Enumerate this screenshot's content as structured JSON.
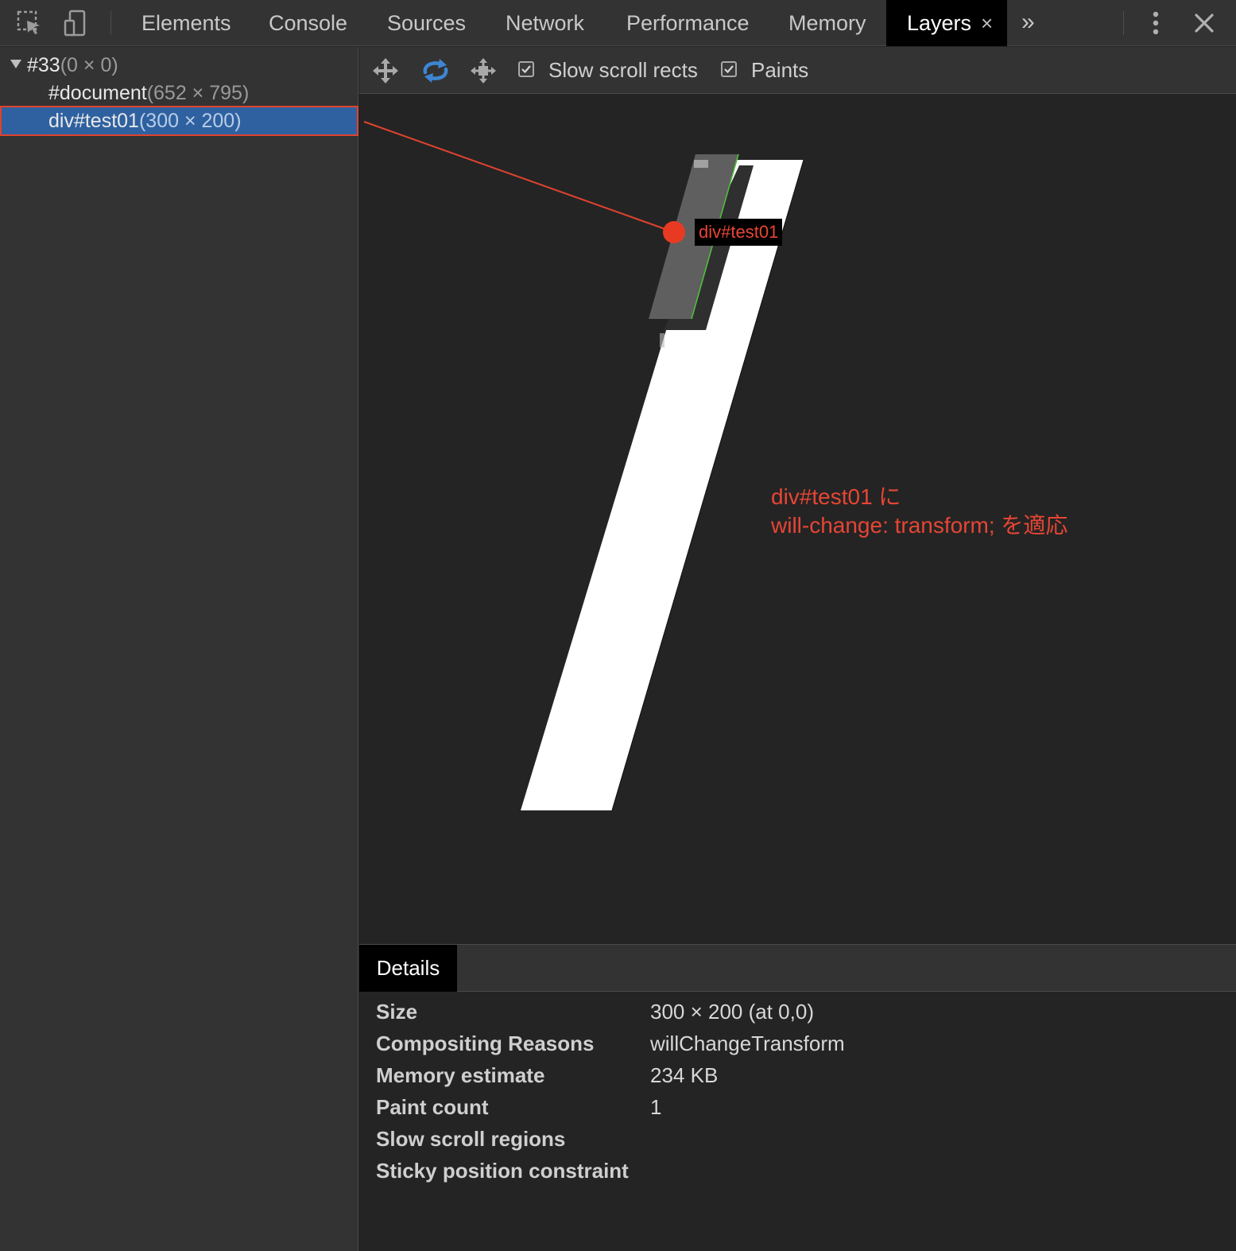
{
  "toolbar": {
    "tabs": [
      "Elements",
      "Console",
      "Sources",
      "Network",
      "Performance",
      "Memory",
      "Layers"
    ],
    "active_tab": "Layers",
    "close_glyph": "×",
    "more_glyph": "»",
    "icons": [
      "inspect-element-icon",
      "device-toolbar-icon",
      "more-tabs-icon",
      "kebab-menu-icon",
      "close-icon"
    ]
  },
  "tree": {
    "root": {
      "name": "#33",
      "dims": "(0 × 0)"
    },
    "items": [
      {
        "name": "#document",
        "dims": "(652 × 795)"
      },
      {
        "name": "div#test01",
        "dims": "(300 × 200)"
      }
    ],
    "selected": "div#test01"
  },
  "layers_toolbar": {
    "icons": [
      "pan-mode-icon",
      "rotate-mode-icon",
      "reset-transform-icon"
    ],
    "active_icon": "rotate-mode-icon",
    "checkboxes": [
      {
        "label": "Slow scroll rects",
        "checked": true
      },
      {
        "label": "Paints",
        "checked": true
      }
    ]
  },
  "viewport": {
    "hover_label": "div#test01",
    "annotation": [
      "div#test01 に",
      "will-change: transform; を適応"
    ],
    "annotation_color": "#e74534"
  },
  "details": {
    "tab": "Details",
    "rows": [
      {
        "key": "Size",
        "value": "300 × 200 (at 0,0)"
      },
      {
        "key": "Compositing Reasons",
        "value": "willChangeTransform"
      },
      {
        "key": "Memory estimate",
        "value": "234 KB"
      },
      {
        "key": "Paint count",
        "value": "1"
      },
      {
        "key": "Slow scroll regions",
        "value": ""
      },
      {
        "key": "Sticky position constraint",
        "value": ""
      }
    ]
  },
  "colors": {
    "selection": "#2f61a0",
    "highlight": "#e0432e",
    "accent_icon": "#3d86d4"
  }
}
